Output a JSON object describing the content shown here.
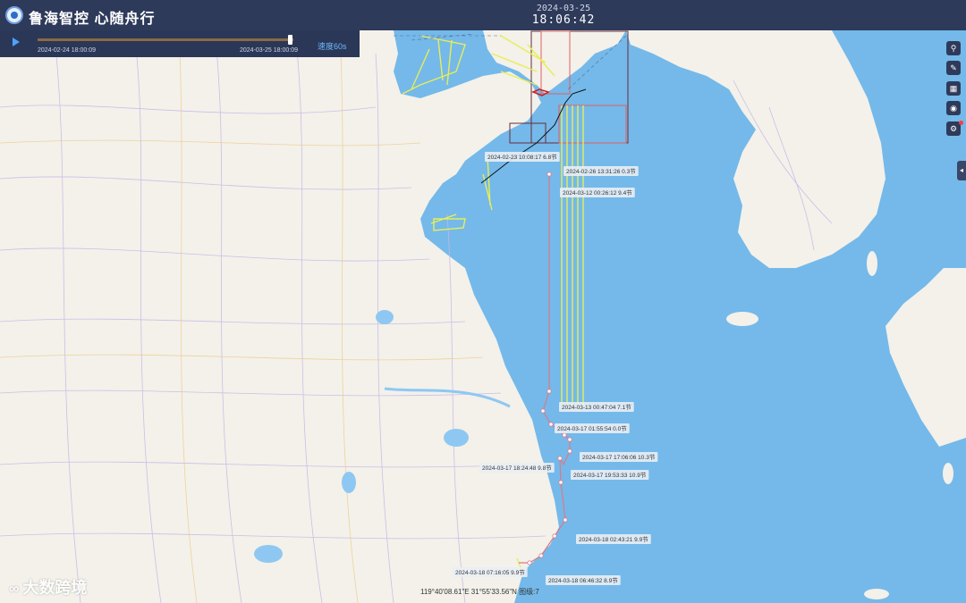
{
  "header": {
    "app_title": "鲁海智控 心随舟行",
    "date": "2024-03-25",
    "clock": "18:06:42"
  },
  "player": {
    "start_label": "2024-02-24 18:00:09",
    "end_label": "2024-03-25 18:00:09",
    "speed_label": "速度60s",
    "progress": 1.0
  },
  "toolbar": {
    "icons": [
      "location-icon",
      "ruler-icon",
      "map-icon",
      "eye-icon",
      "settings-icon"
    ]
  },
  "track_labels": [
    {
      "text": "2024-02-23 10:08:17 6.8节"
    },
    {
      "text": "2024-02-26 13:31:26 0.3节"
    },
    {
      "text": "2024-03-12 00:26:12 9.4节"
    },
    {
      "text": "2024-03-13 00:47:04 7.1节"
    },
    {
      "text": "2024-03-17 01:55:54 0.0节"
    },
    {
      "text": "2024-03-17 17:06:06 10.3节"
    },
    {
      "text": "2024-03-17 18:24:48 9.8节"
    },
    {
      "text": "2024-03-17 19:53:33 10.9节"
    },
    {
      "text": "2024-03-18 02:43:21 9.9节"
    },
    {
      "text": "2024-03-18 07:16:05 9.9节"
    },
    {
      "text": "2024-03-18 06:46:32 8.9节"
    }
  ],
  "status_bar": {
    "coordinates": "119°40'08.61\"E  31°55'33.56\"N   图级:7"
  },
  "watermark": "大数跨境",
  "colors": {
    "sea": "#74b9ea",
    "land": "#f3f1ea",
    "track": "#d97a8a",
    "lanes": "#e8ee55",
    "header": "#2e3a5a"
  }
}
